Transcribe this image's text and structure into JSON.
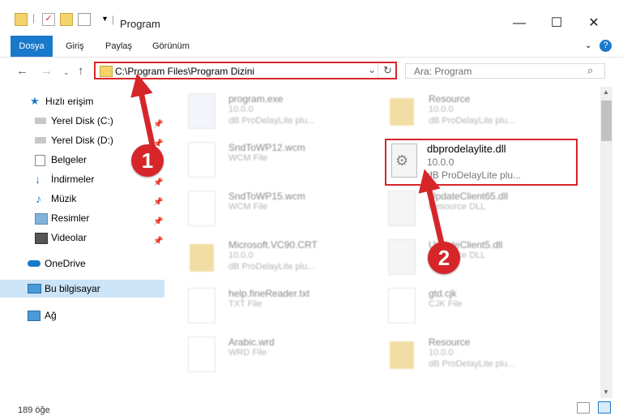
{
  "window": {
    "title": "Program",
    "minimize_icon": "minimize-icon",
    "maximize_icon": "maximize-icon",
    "close_icon": "close-icon"
  },
  "ribbon": {
    "tabs": [
      {
        "label": "Dosya"
      },
      {
        "label": "Giriş"
      },
      {
        "label": "Paylaş"
      },
      {
        "label": "Görünüm"
      }
    ],
    "help": "?"
  },
  "address": {
    "path": "C:\\Program Files\\Program Dizini",
    "refresh": "↻",
    "dropdown": "⌄"
  },
  "search": {
    "placeholder": "Ara: Program"
  },
  "sidebar": {
    "items": [
      {
        "label": "Hızlı erişim",
        "icon": "star-icon"
      },
      {
        "label": "Yerel Disk (C:)",
        "icon": "drive-icon",
        "pinned": true
      },
      {
        "label": "Yerel Disk (D:)",
        "icon": "drive-icon",
        "pinned": true
      },
      {
        "label": "Belgeler",
        "icon": "documents-icon",
        "pinned": true
      },
      {
        "label": "İndirmeler",
        "icon": "download-icon",
        "pinned": true
      },
      {
        "label": "Müzik",
        "icon": "music-icon",
        "pinned": true
      },
      {
        "label": "Resimler",
        "icon": "pictures-icon",
        "pinned": true
      },
      {
        "label": "Videolar",
        "icon": "video-icon",
        "pinned": true
      },
      {
        "label": "OneDrive",
        "icon": "cloud-icon"
      },
      {
        "label": "Bu bilgisayar",
        "icon": "computer-icon",
        "selected": true
      },
      {
        "label": "Ağ",
        "icon": "network-icon"
      }
    ]
  },
  "files": {
    "left": [
      {
        "name": "program.exe",
        "l2": "10.0.0",
        "l3": "dB ProDelayLite plu...",
        "kind": "exe"
      },
      {
        "name": "SndToWP12.wcm",
        "l2": "WCM File",
        "l3": "",
        "kind": "doc"
      },
      {
        "name": "SndToWP15.wcm",
        "l2": "WCM File",
        "l3": "",
        "kind": "doc"
      },
      {
        "name": "Microsoft.VC90.CRT",
        "l2": "10.0.0",
        "l3": "dB ProDelayLite plu...",
        "kind": "folder"
      },
      {
        "name": "help.fineReader.txt",
        "l2": "TXT File",
        "l3": "",
        "kind": "doc"
      },
      {
        "name": "Arabic.wrd",
        "l2": "WRD File",
        "l3": "",
        "kind": "doc"
      }
    ],
    "right": [
      {
        "name": "Resource",
        "l2": "10.0.0",
        "l3": "dB ProDelayLite plu...",
        "kind": "folder"
      },
      {
        "name": "UpdateClient65.dll",
        "l2": "Resource DLL",
        "l3": "",
        "kind": "dll"
      },
      {
        "name": "UpdateClient5.dll",
        "l2": "Resource DLL",
        "l3": "",
        "kind": "dll"
      },
      {
        "name": "gtd.cjk",
        "l2": "CJK File",
        "l3": "",
        "kind": "doc"
      },
      {
        "name": "Resource",
        "l2": "10.0.0",
        "l3": "dB ProDelayLite plu...",
        "kind": "folder"
      }
    ],
    "highlighted": {
      "name": "dbprodelaylite.dll",
      "version": "10.0.0",
      "description": "dB ProDelayLite plu..."
    }
  },
  "status": {
    "count": "189 öğe"
  },
  "callouts": [
    "1",
    "2"
  ],
  "colors": {
    "accent": "#1979ca",
    "highlight": "#d6262a"
  }
}
